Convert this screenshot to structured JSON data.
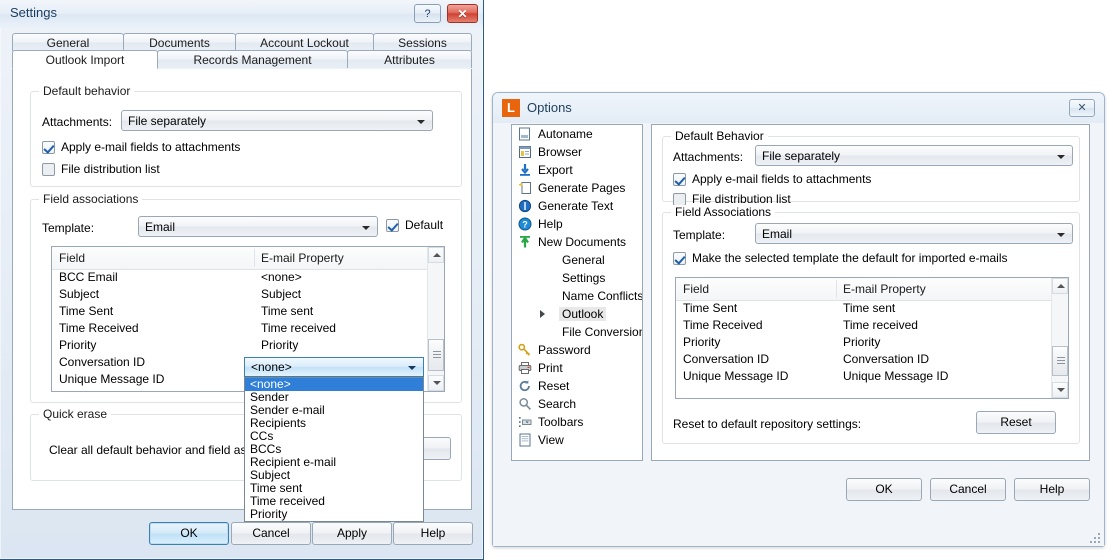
{
  "settings": {
    "title": "Settings",
    "help_btn": "?",
    "close_btn": "✕",
    "tabs_row1": [
      {
        "label": "General"
      },
      {
        "label": "Documents"
      },
      {
        "label": "Account Lockout"
      },
      {
        "label": "Sessions"
      }
    ],
    "tabs_row2": [
      {
        "label": "Outlook Import",
        "active": true
      },
      {
        "label": "Records Management"
      },
      {
        "label": "Attributes"
      }
    ],
    "default_behavior": {
      "title": "Default behavior",
      "attachments_label": "Attachments:",
      "attachments_value": "File separately",
      "apply_fields_label": "Apply e-mail fields to attachments",
      "apply_fields_checked": true,
      "file_dist_label": "File distribution list",
      "file_dist_checked": false
    },
    "field_associations": {
      "title": "Field associations",
      "template_label": "Template:",
      "template_value": "Email",
      "default_label": "Default",
      "default_checked": true,
      "columns": [
        "Field",
        "E-mail Property"
      ],
      "rows": [
        {
          "field": "BCC Email",
          "property": "<none>"
        },
        {
          "field": "Subject",
          "property": "Subject"
        },
        {
          "field": "Time Sent",
          "property": "Time sent"
        },
        {
          "field": "Time Received",
          "property": "Time received"
        },
        {
          "field": "Priority",
          "property": "Priority"
        },
        {
          "field": "Conversation ID",
          "property": ""
        },
        {
          "field": "Unique Message ID",
          "property": ""
        }
      ]
    },
    "editing_combo": {
      "value": "<none>",
      "options": [
        "<none>",
        "Sender",
        "Sender e-mail",
        "Recipients",
        "CCs",
        "BCCs",
        "Recipient e-mail",
        "Subject",
        "Time sent",
        "Time received",
        "Priority"
      ],
      "selected_index": 0
    },
    "quick_erase": {
      "title": "Quick erase",
      "description": "Clear all default behavior and field associat"
    },
    "buttons": {
      "ok": "OK",
      "cancel": "Cancel",
      "apply": "Apply",
      "help": "Help"
    }
  },
  "options": {
    "title": "Options",
    "app_icon_letter": "L",
    "close_btn": "✕",
    "tree": [
      {
        "label": "Autoname",
        "icon": "autoname-icon",
        "indent": 0
      },
      {
        "label": "Browser",
        "icon": "browser-icon",
        "indent": 0
      },
      {
        "label": "Export",
        "icon": "export-icon",
        "indent": 0
      },
      {
        "label": "Generate Pages",
        "icon": "generate-pages-icon",
        "indent": 0
      },
      {
        "label": "Generate Text",
        "icon": "generate-text-icon",
        "indent": 0
      },
      {
        "label": "Help",
        "icon": "help-icon",
        "indent": 0
      },
      {
        "label": "New Documents",
        "icon": "new-documents-icon",
        "indent": 0
      },
      {
        "label": "General",
        "icon": "",
        "indent": 1
      },
      {
        "label": "Settings",
        "icon": "",
        "indent": 1
      },
      {
        "label": "Name Conflicts",
        "icon": "",
        "indent": 1
      },
      {
        "label": "Outlook",
        "icon": "",
        "indent": 1,
        "selected": true,
        "expandable": true
      },
      {
        "label": "File Conversion",
        "icon": "",
        "indent": 1
      },
      {
        "label": "Password",
        "icon": "password-icon",
        "indent": 0
      },
      {
        "label": "Print",
        "icon": "print-icon",
        "indent": 0
      },
      {
        "label": "Reset",
        "icon": "reset-icon",
        "indent": 0
      },
      {
        "label": "Search",
        "icon": "search-icon",
        "indent": 0
      },
      {
        "label": "Toolbars",
        "icon": "toolbars-icon",
        "indent": 0
      },
      {
        "label": "View",
        "icon": "view-icon",
        "indent": 0
      }
    ],
    "default_behavior": {
      "title": "Default Behavior",
      "attachments_label": "Attachments:",
      "attachments_value": "File separately",
      "apply_fields_label": "Apply e-mail fields to attachments",
      "apply_fields_checked": true,
      "file_dist_label": "File distribution list",
      "file_dist_checked": false
    },
    "field_associations": {
      "title": "Field Associations",
      "template_label": "Template:",
      "template_value": "Email",
      "make_default_label": "Make the selected template the default for imported e-mails",
      "make_default_checked": true,
      "columns": [
        "Field",
        "E-mail Property"
      ],
      "rows": [
        {
          "field": "Time Sent",
          "property": "Time sent"
        },
        {
          "field": "Time Received",
          "property": "Time received"
        },
        {
          "field": "Priority",
          "property": "Priority"
        },
        {
          "field": "Conversation ID",
          "property": "Conversation ID"
        },
        {
          "field": "Unique Message ID",
          "property": "Unique Message ID"
        }
      ]
    },
    "reset_row": {
      "label": "Reset to default repository settings:",
      "button": "Reset"
    },
    "buttons": {
      "ok": "OK",
      "cancel": "Cancel",
      "help": "Help"
    }
  }
}
